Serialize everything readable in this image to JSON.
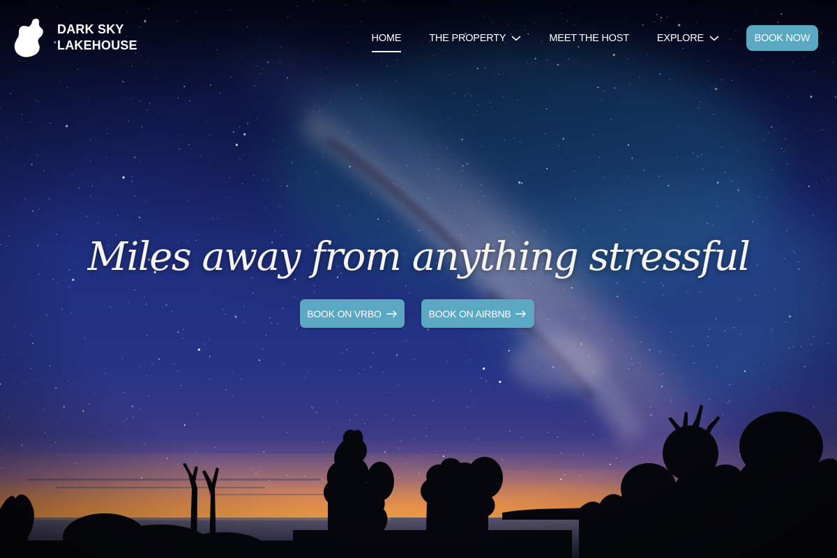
{
  "brand": {
    "line1": "DARK SKY",
    "line2": "LAKEHOUSE",
    "logo_icon": "lake-silhouette-icon"
  },
  "nav": {
    "items": [
      {
        "label": "HOME",
        "active": true,
        "dropdown": false
      },
      {
        "label": "THE PROPERTY",
        "active": false,
        "dropdown": true,
        "icon": "chevron-down-icon"
      },
      {
        "label": "MEET THE HOST",
        "active": false,
        "dropdown": false
      },
      {
        "label": "EXPLORE",
        "active": false,
        "dropdown": true,
        "icon": "chevron-down-icon"
      }
    ],
    "book_now_label": "BOOK NOW"
  },
  "hero": {
    "title": "Miles away from anything stressful",
    "buttons": [
      {
        "label": "BOOK ON VRBO",
        "icon": "arrow-right-icon"
      },
      {
        "label": "BOOK ON AIRBNB",
        "icon": "arrow-right-icon"
      }
    ],
    "background": "milky-way-over-lake-photo"
  },
  "colors": {
    "accent": "#5aa8c2",
    "sky_top": "#0b1236",
    "sky_mid": "#1c2f78",
    "horizon_glow": "#e8893a",
    "text": "#ffffff"
  }
}
